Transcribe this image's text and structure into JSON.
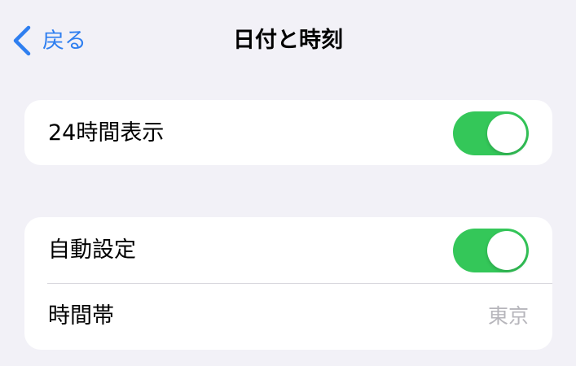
{
  "colors": {
    "accent": "#2f7ff0",
    "toggle_on": "#34c759",
    "background": "#f2f1f7",
    "secondary_text": "#b6b5bb"
  },
  "navbar": {
    "back_label": "戻る",
    "back_icon": "chevron-left-icon",
    "title": "日付と時刻"
  },
  "settings": {
    "group1": {
      "time_24h": {
        "label": "24時間表示",
        "toggle_on": true
      }
    },
    "group2": {
      "auto_set": {
        "label": "自動設定",
        "toggle_on": true
      },
      "time_zone": {
        "label": "時間帯",
        "value": "東京"
      }
    }
  }
}
